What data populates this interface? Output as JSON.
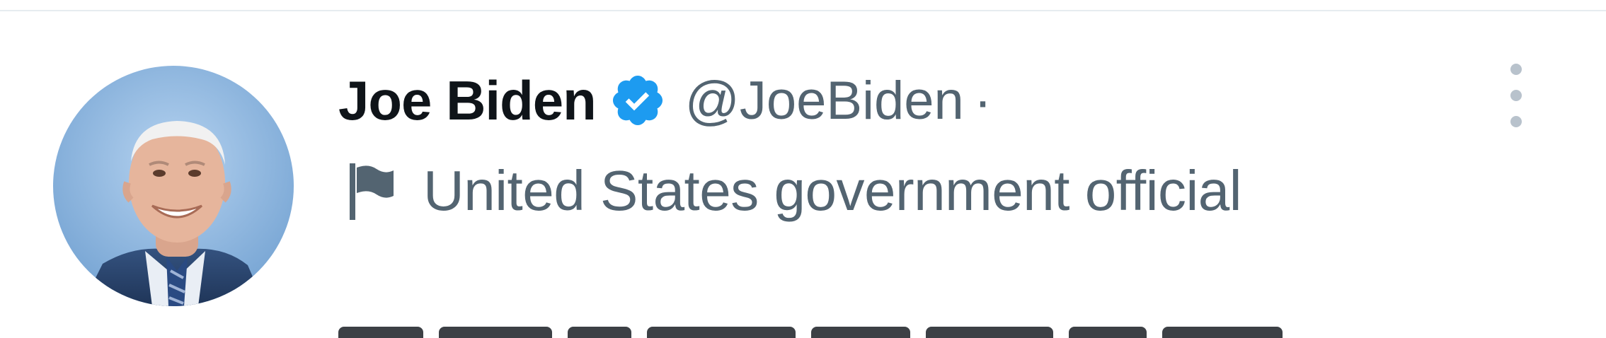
{
  "tweet": {
    "author": {
      "display_name": "Joe Biden",
      "handle": "@JoeBiden",
      "separator": "·",
      "verified": true,
      "avatar_icon": "avatar-photo"
    },
    "label": {
      "icon": "flag-icon",
      "text": "United States government official"
    },
    "more_icon": "more-options-icon"
  },
  "colors": {
    "name": "#0f1419",
    "secondary": "#536471",
    "verified_badge": "#1d9bf0",
    "divider": "#e6ecf0"
  }
}
